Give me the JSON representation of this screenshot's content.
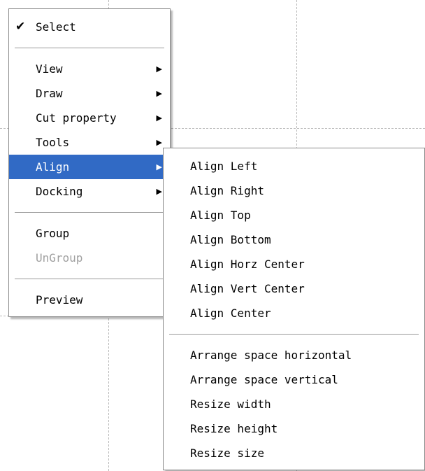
{
  "main_menu": {
    "select": {
      "label": "Select",
      "checked": true,
      "check_icon": "checkmark-icon"
    },
    "group1": [
      {
        "label": "View",
        "submenu": true
      },
      {
        "label": "Draw",
        "submenu": true
      },
      {
        "label": "Cut property",
        "submenu": true
      },
      {
        "label": "Tools",
        "submenu": true
      },
      {
        "label": "Align",
        "submenu": true,
        "highlighted": true
      },
      {
        "label": "Docking",
        "submenu": true
      }
    ],
    "group2": [
      {
        "label": "Group",
        "enabled": true
      },
      {
        "label": "UnGroup",
        "enabled": false
      }
    ],
    "group3": [
      {
        "label": "Preview"
      }
    ],
    "submenu_arrow_icon": "submenu-arrow-icon"
  },
  "align_submenu": {
    "align_items": [
      {
        "label": "Align Left"
      },
      {
        "label": "Align Right"
      },
      {
        "label": "Align Top"
      },
      {
        "label": "Align Bottom"
      },
      {
        "label": "Align Horz Center"
      },
      {
        "label": "Align Vert Center"
      },
      {
        "label": "Align Center"
      }
    ],
    "arrange_items": [
      {
        "label": "Arrange space horizontal"
      },
      {
        "label": "Arrange space vertical"
      },
      {
        "label": "Resize width"
      },
      {
        "label": "Resize height"
      },
      {
        "label": "Resize size"
      }
    ]
  },
  "colors": {
    "highlight": "#316ac5",
    "disabled_text": "#a0a0a0",
    "guide_line": "#b9b9b9"
  }
}
